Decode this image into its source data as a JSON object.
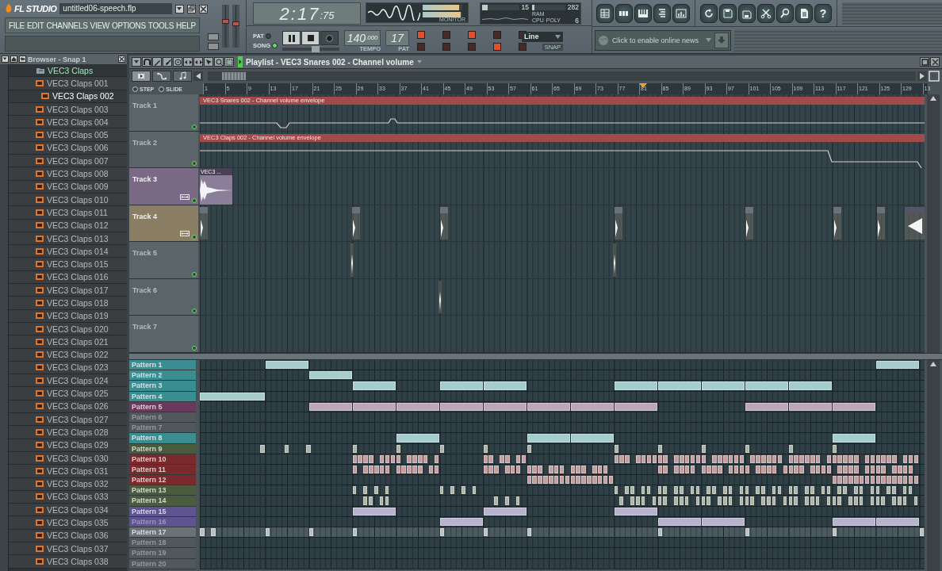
{
  "app": {
    "logo": "FL STUDIO",
    "file_title": "untitled06-speech.flp"
  },
  "menu": [
    "FILE",
    "EDIT",
    "CHANNELS",
    "VIEW",
    "OPTIONS",
    "TOOLS",
    "HELP"
  ],
  "faders": [
    {
      "level": 0.62
    },
    {
      "level": 0.55
    }
  ],
  "transport": {
    "time": "2:17",
    "time_fraction": ":75",
    "modes": [
      {
        "label": "PAT",
        "selected": false
      },
      {
        "label": "SONG",
        "selected": true
      }
    ],
    "position": {
      "level": 0.6
    },
    "tempo": "140",
    "tempo_fraction": ".000",
    "tempo_label": "TEMPO",
    "pattern": "17",
    "pattern_label": "PAT"
  },
  "monitor": {
    "label": "MONITOR",
    "meters": [
      {
        "level": 0.92
      },
      {
        "level": 0.95
      }
    ]
  },
  "cpu": {
    "meters": [
      {
        "level": 0.15,
        "reading": "15"
      },
      {
        "level": 0.08,
        "reading": "282"
      }
    ],
    "ram_label": "RAM",
    "cpu_label": "CPU",
    "poly_label": "POLY",
    "poly": "6"
  },
  "toggles": [
    {
      "on": true
    },
    {
      "on": false
    },
    {
      "on": true
    },
    {
      "on": false
    },
    {
      "on": false
    },
    {
      "on": false
    },
    {
      "on": false
    },
    {
      "on": false
    },
    {
      "on": true
    },
    {
      "on": false
    }
  ],
  "snap": {
    "value": "Line",
    "label": "SNAP"
  },
  "help_button": "?",
  "news": {
    "placeholder": "Click to enable online news"
  },
  "browser": {
    "title": "Browser - Snap 1",
    "items": [
      {
        "label": "VEC3 Claps",
        "expanded": true,
        "children": [
          {
            "label": "VEC3 Claps 001",
            "selected": false
          },
          {
            "label": "VEC3 Claps 002",
            "selected": true
          },
          {
            "label": "VEC3 Claps 003",
            "selected": false
          },
          {
            "label": "VEC3 Claps 004",
            "selected": false
          },
          {
            "label": "VEC3 Claps 005",
            "selected": false
          },
          {
            "label": "VEC3 Claps 006",
            "selected": false
          },
          {
            "label": "VEC3 Claps 007",
            "selected": false
          },
          {
            "label": "VEC3 Claps 008",
            "selected": false
          },
          {
            "label": "VEC3 Claps 009",
            "selected": false
          },
          {
            "label": "VEC3 Claps 010",
            "selected": false
          },
          {
            "label": "VEC3 Claps 011",
            "selected": false
          },
          {
            "label": "VEC3 Claps 012",
            "selected": false
          },
          {
            "label": "VEC3 Claps 013",
            "selected": false
          },
          {
            "label": "VEC3 Claps 014",
            "selected": false
          },
          {
            "label": "VEC3 Claps 015",
            "selected": false
          },
          {
            "label": "VEC3 Claps 016",
            "selected": false
          },
          {
            "label": "VEC3 Claps 017",
            "selected": false
          },
          {
            "label": "VEC3 Claps 018",
            "selected": false
          },
          {
            "label": "VEC3 Claps 019",
            "selected": false
          },
          {
            "label": "VEC3 Claps 020",
            "selected": false
          },
          {
            "label": "VEC3 Claps 021",
            "selected": false
          },
          {
            "label": "VEC3 Claps 022",
            "selected": false
          },
          {
            "label": "VEC3 Claps 023",
            "selected": false
          },
          {
            "label": "VEC3 Claps 024",
            "selected": false
          },
          {
            "label": "VEC3 Claps 025",
            "selected": false
          },
          {
            "label": "VEC3 Claps 026",
            "selected": false
          },
          {
            "label": "VEC3 Claps 027",
            "selected": false
          },
          {
            "label": "VEC3 Claps 028",
            "selected": false
          },
          {
            "label": "VEC3 Claps 029",
            "selected": false
          },
          {
            "label": "VEC3 Claps 030",
            "selected": false
          },
          {
            "label": "VEC3 Claps 031",
            "selected": false
          },
          {
            "label": "VEC3 Claps 032",
            "selected": false
          },
          {
            "label": "VEC3 Claps 033",
            "selected": false
          },
          {
            "label": "VEC3 Claps 034",
            "selected": false
          },
          {
            "label": "VEC3 Claps 035",
            "selected": false
          },
          {
            "label": "VEC3 Claps 036",
            "selected": false
          },
          {
            "label": "VEC3 Claps 037",
            "selected": false
          },
          {
            "label": "VEC3 Claps 038",
            "selected": false
          }
        ]
      }
    ]
  },
  "playlist": {
    "title": "Playlist - VEC3 Snares 002 - Channel volume",
    "view_tabs": [
      {
        "selected": true
      },
      {
        "selected": false
      },
      {
        "selected": false
      }
    ],
    "snap_options": [
      {
        "label": "STEP",
        "selected": false
      },
      {
        "label": "SLIDE",
        "selected": false
      }
    ],
    "ruler": [
      "1",
      "5",
      "9",
      "13",
      "17",
      "21",
      "25",
      "29",
      "33",
      "37",
      "41",
      "45",
      "49",
      "53",
      "57",
      "61",
      "65",
      "69",
      "73",
      "77",
      "81",
      "85",
      "89",
      "93",
      "97",
      "101",
      "105",
      "109",
      "113",
      "117",
      "121",
      "125",
      "129",
      "13"
    ],
    "tracks": [
      {
        "name": "Track 1",
        "kind": "automation",
        "color": "#5b6569",
        "highlighted": false,
        "clip_label": "VEC3 Snares 002 - Channel volume envelope"
      },
      {
        "name": "Track 2",
        "kind": "automation",
        "color": "#5b6569",
        "highlighted": false,
        "clip_label": "VEC3 Claps 002 - Channel volume envelope"
      },
      {
        "name": "Track 3",
        "kind": "audio",
        "color": "#7a6a86",
        "highlighted": true,
        "clip_label": "VEC3 ..."
      },
      {
        "name": "Track 4",
        "kind": "hits",
        "color": "#8a7e64",
        "highlighted": true
      },
      {
        "name": "Track 5",
        "kind": "hits",
        "color": "#5b6569",
        "highlighted": false
      },
      {
        "name": "Track 6",
        "kind": "hits",
        "color": "#5b6569",
        "highlighted": false
      },
      {
        "name": "Track 7",
        "kind": "empty",
        "color": "#5b6569",
        "highlighted": false
      }
    ],
    "patterns": [
      {
        "name": "Pattern 1",
        "color": "#3a8e92",
        "empty": false,
        "selected": false
      },
      {
        "name": "Pattern 2",
        "color": "#3a8e92",
        "empty": false,
        "selected": false
      },
      {
        "name": "Pattern 3",
        "color": "#3a8e92",
        "empty": false,
        "selected": false
      },
      {
        "name": "Pattern 4",
        "color": "#3a8e92",
        "empty": false,
        "selected": false
      },
      {
        "name": "Pattern 5",
        "color": "#6a3a5e",
        "empty": false,
        "selected": false
      },
      {
        "name": "Pattern 6",
        "color": "#50585c",
        "empty": true,
        "selected": false
      },
      {
        "name": "Pattern 7",
        "color": "#50585c",
        "empty": true,
        "selected": false
      },
      {
        "name": "Pattern 8",
        "color": "#3a8e92",
        "empty": false,
        "selected": false
      },
      {
        "name": "Pattern 9",
        "color": "#4a5a3c",
        "empty": false,
        "selected": false
      },
      {
        "name": "Pattern 10",
        "color": "#7a2a2a",
        "empty": false,
        "selected": false
      },
      {
        "name": "Pattern 11",
        "color": "#7a2a2a",
        "empty": false,
        "selected": false
      },
      {
        "name": "Pattern 12",
        "color": "#7a2a2a",
        "empty": false,
        "selected": false
      },
      {
        "name": "Pattern 13",
        "color": "#4a5c3e",
        "empty": false,
        "selected": false
      },
      {
        "name": "Pattern 14",
        "color": "#4a5c3e",
        "empty": false,
        "selected": false
      },
      {
        "name": "Pattern 15",
        "color": "#5e5490",
        "empty": false,
        "selected": false
      },
      {
        "name": "Pattern 16",
        "color": "#5e5490",
        "empty": true,
        "selected": false
      },
      {
        "name": "Pattern 17",
        "color": "#6a7276",
        "empty": false,
        "selected": true
      },
      {
        "name": "Pattern 18",
        "color": "#50585c",
        "empty": true,
        "selected": false
      },
      {
        "name": "Pattern 19",
        "color": "#50585c",
        "empty": true,
        "selected": false
      },
      {
        "name": "Pattern 20",
        "color": "#50585c",
        "empty": true,
        "selected": false
      }
    ]
  }
}
